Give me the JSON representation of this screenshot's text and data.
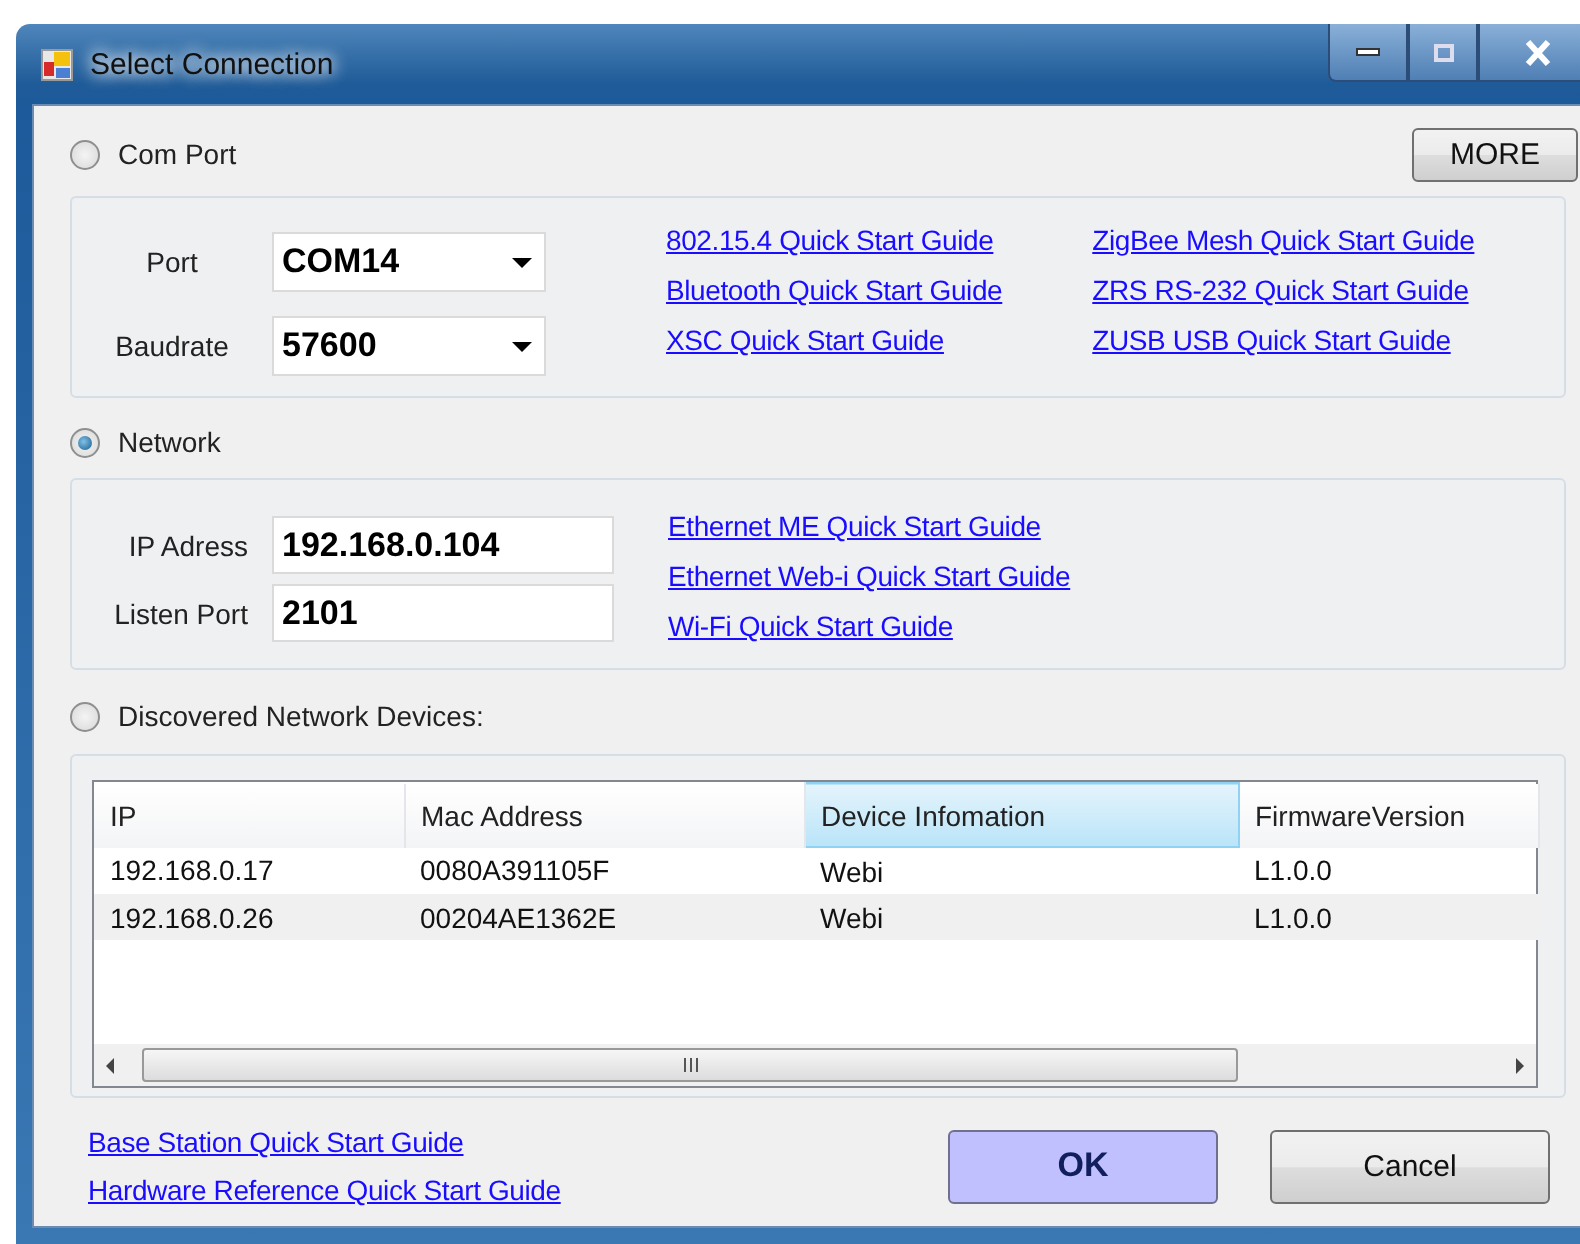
{
  "window": {
    "title": "Select Connection"
  },
  "com_port": {
    "label": "Com Port",
    "selected": false,
    "more_button": "MORE",
    "fields": [
      {
        "label": "Port",
        "value": "COM14"
      },
      {
        "label": "Baudrate",
        "value": "57600"
      }
    ],
    "links": [
      [
        "802.15.4 Quick Start Guide",
        "Bluetooth Quick Start Guide",
        "XSC Quick Start Guide"
      ],
      [
        "ZigBee Mesh Quick Start Guide",
        "ZRS RS-232 Quick Start Guide",
        "ZUSB USB Quick Start Guide"
      ]
    ]
  },
  "network": {
    "label": "Network",
    "selected": true,
    "fields": [
      {
        "label": "IP Adress",
        "value": "192.168.0.104"
      },
      {
        "label": "Listen Port",
        "value": "2101"
      }
    ],
    "links": [
      "Ethernet ME Quick Start Guide",
      "Ethernet Web-i Quick Start Guide",
      "Wi-Fi Quick Start Guide"
    ]
  },
  "discovered": {
    "label": "Discovered Network Devices:",
    "selected": false,
    "table": {
      "columns": [
        {
          "label": "IP",
          "highlighted": false
        },
        {
          "label": "Mac Address",
          "highlighted": false
        },
        {
          "label": "Device Infomation",
          "highlighted": true
        },
        {
          "label": "FirmwareVersion",
          "highlighted": false
        }
      ],
      "rows": [
        {
          "selected": false,
          "cells": [
            "192.168.0.17",
            "0080A391105F",
            "Webi",
            "L1.0.0"
          ]
        },
        {
          "selected": true,
          "cells": [
            "192.168.0.26",
            "00204AE1362E",
            "Webi",
            "L1.0.0"
          ]
        }
      ]
    }
  },
  "footer_links": [
    "Base Station Quick Start Guide",
    "Hardware Reference Quick Start Guide"
  ],
  "buttons": [
    {
      "label": "OK",
      "default": true
    },
    {
      "label": "Cancel",
      "default": false
    }
  ]
}
